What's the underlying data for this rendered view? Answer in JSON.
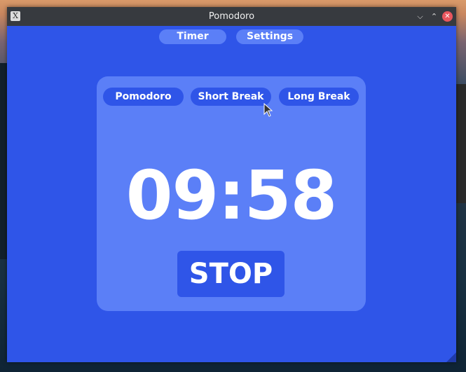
{
  "window": {
    "title": "Pomodoro",
    "app_icon": "X",
    "minimize_icon": "chevron-down-icon",
    "maximize_icon": "chevron-up-icon",
    "close_icon": "close-icon"
  },
  "nav": {
    "tabs": [
      {
        "label": "Timer"
      },
      {
        "label": "Settings"
      }
    ]
  },
  "timer": {
    "modes": [
      {
        "label": "Pomodoro"
      },
      {
        "label": "Short Break"
      },
      {
        "label": "Long Break"
      }
    ],
    "display": "09:58",
    "action_label": "STOP"
  },
  "colors": {
    "background": "#2f55e8",
    "card": "#5b7ff7",
    "button": "#2f55e8",
    "text": "#ffffff",
    "titlebar": "#373a3f",
    "close": "#e8565e"
  }
}
